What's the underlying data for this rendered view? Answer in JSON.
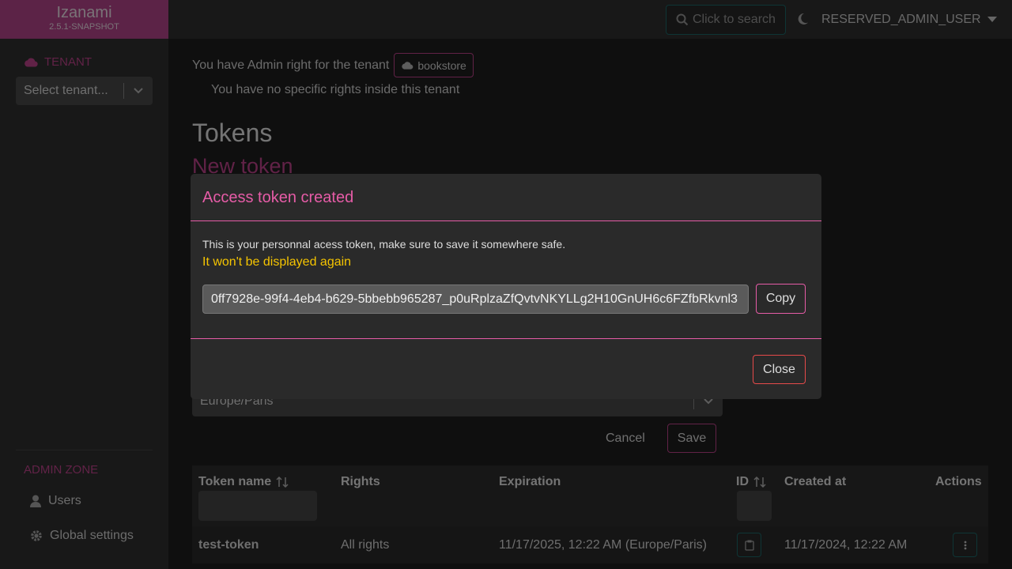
{
  "app": {
    "name": "Izanami",
    "version": "2.5.1-SNAPSHOT"
  },
  "sidebar": {
    "tenant_label": "TENANT",
    "tenant_placeholder": "Select tenant...",
    "admin_zone_label": "ADMIN ZONE",
    "links": [
      {
        "label": "Users",
        "icon": "user-icon"
      },
      {
        "label": "Global settings",
        "icon": "gear-icon"
      }
    ]
  },
  "topbar": {
    "search_label": "Click to search",
    "user_name": "RESERVED_ADMIN_USER"
  },
  "main": {
    "admin_right_text": "You have Admin right for the tenant",
    "tenant_chip": "bookstore",
    "no_rights_text": "You have no specific rights inside this tenant",
    "title": "Tokens",
    "subtitle": "New token",
    "timezone_value": "Europe/Paris",
    "cancel_label": "Cancel",
    "save_label": "Save"
  },
  "table": {
    "headers": {
      "name": "Token name",
      "rights": "Rights",
      "expiration": "Expiration",
      "id": "ID",
      "created": "Created at",
      "actions": "Actions"
    },
    "rows": [
      {
        "name": "test-token",
        "rights": "All rights",
        "expiration": "11/17/2025, 12:22 AM (Europe/Paris)",
        "created": "11/17/2024, 12:22 AM"
      }
    ]
  },
  "modal": {
    "title": "Access token created",
    "message": "This is your personnal acess token, make sure to save it somewhere safe.",
    "warning": "It won't be displayed again",
    "token_value": "0ff7928e-99f4-4eb4-b629-5bbebb965287_p0uRplzaZfQvtvNKYLLg2H10GnUH6c6FZfbRkvnl3",
    "copy_label": "Copy",
    "close_label": "Close"
  },
  "colors": {
    "brand": "#b8468e",
    "accent": "#e65ca7",
    "warning": "#f5c400",
    "teal": "#1c6a6b"
  }
}
